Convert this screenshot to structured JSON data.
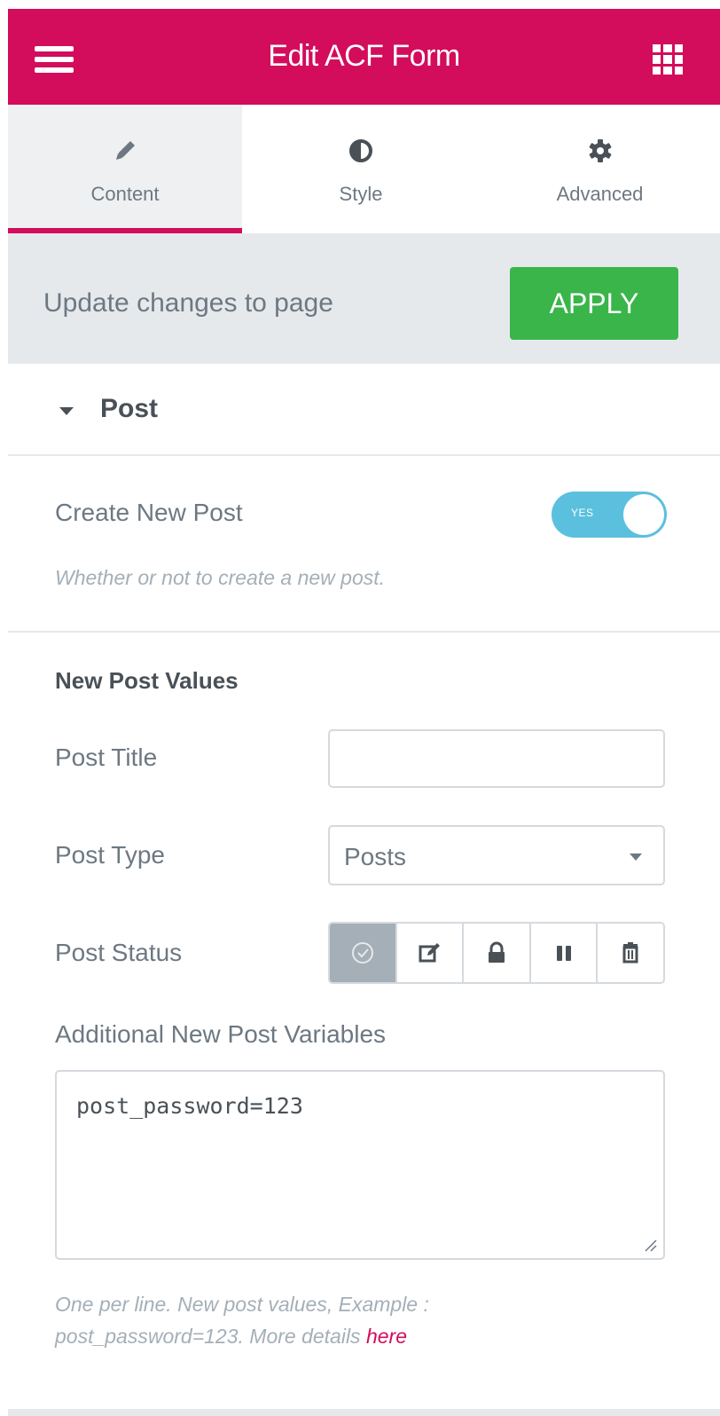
{
  "header": {
    "title": "Edit ACF Form",
    "menu_icon": "hamburger-icon",
    "apps_icon": "grid-icon",
    "color": "#d30c5c"
  },
  "tabs": [
    {
      "label": "Content",
      "icon": "pencil-icon",
      "active": true
    },
    {
      "label": "Style",
      "icon": "half-circle-icon",
      "active": false
    },
    {
      "label": "Advanced",
      "icon": "gear-icon",
      "active": false
    }
  ],
  "apply_bar": {
    "text": "Update changes to page",
    "button_label": "APPLY",
    "button_color": "#39b54a"
  },
  "section": {
    "title": "Post",
    "create_new_post": {
      "label": "Create New Post",
      "toggle_text": "YES",
      "toggle_on": true,
      "description": "Whether or not to create a new post."
    },
    "new_post_values": {
      "heading": "New Post Values",
      "post_title": {
        "label": "Post Title",
        "value": ""
      },
      "post_type": {
        "label": "Post Type",
        "value": "Posts"
      },
      "post_status": {
        "label": "Post Status",
        "options": [
          "check-circle-icon",
          "edit-icon",
          "lock-icon",
          "pause-icon",
          "trash-icon"
        ],
        "selected": "check-circle-icon"
      },
      "additional_vars": {
        "label": "Additional New Post Variables",
        "value": "post_password=123",
        "description": "One per line. New post values, Example : post_password=123. More details ",
        "link_text": "here"
      }
    }
  }
}
